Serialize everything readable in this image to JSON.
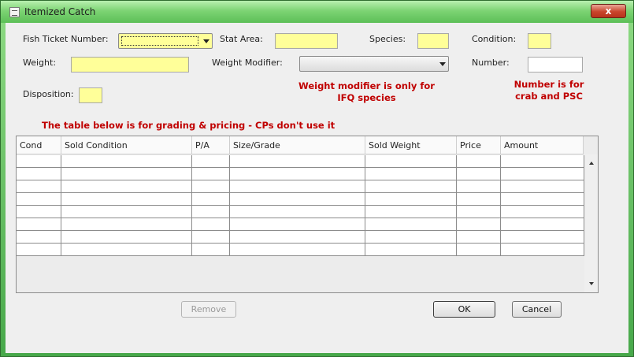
{
  "window": {
    "title": "Itemized Catch",
    "close_label": "x"
  },
  "form": {
    "fish_ticket_label": "Fish Ticket Number:",
    "stat_area_label": "Stat Area:",
    "species_label": "Species:",
    "condition_label": "Condition:",
    "weight_label": "Weight:",
    "weight_modifier_label": "Weight Modifier:",
    "number_label": "Number:",
    "disposition_label": "Disposition:",
    "fish_ticket_value": "",
    "stat_area_value": "",
    "species_value": "",
    "condition_value": "",
    "weight_value": "",
    "weight_modifier_value": "",
    "number_value": "",
    "disposition_value": ""
  },
  "notes": {
    "weight_modifier": "Weight modifier is only for IFQ species",
    "number": "Number is for crab and PSC",
    "table": "The table below is for grading & pricing - CPs don't use it"
  },
  "table": {
    "columns": [
      "Cond",
      "Sold Condition",
      "P/A",
      "Size/Grade",
      "Sold Weight",
      "Price",
      "Amount"
    ],
    "rows": [
      [
        "",
        "",
        "",
        "",
        "",
        "",
        ""
      ],
      [
        "",
        "",
        "",
        "",
        "",
        "",
        ""
      ],
      [
        "",
        "",
        "",
        "",
        "",
        "",
        ""
      ],
      [
        "",
        "",
        "",
        "",
        "",
        "",
        ""
      ],
      [
        "",
        "",
        "",
        "",
        "",
        "",
        ""
      ],
      [
        "",
        "",
        "",
        "",
        "",
        "",
        ""
      ],
      [
        "",
        "",
        "",
        "",
        "",
        "",
        ""
      ],
      [
        "",
        "",
        "",
        "",
        "",
        "",
        ""
      ]
    ]
  },
  "buttons": {
    "remove": "Remove",
    "ok": "OK",
    "cancel": "Cancel"
  },
  "colors": {
    "required_field": "#ffff99",
    "note_text": "#c00000",
    "window_frame": "#5cbf57"
  }
}
